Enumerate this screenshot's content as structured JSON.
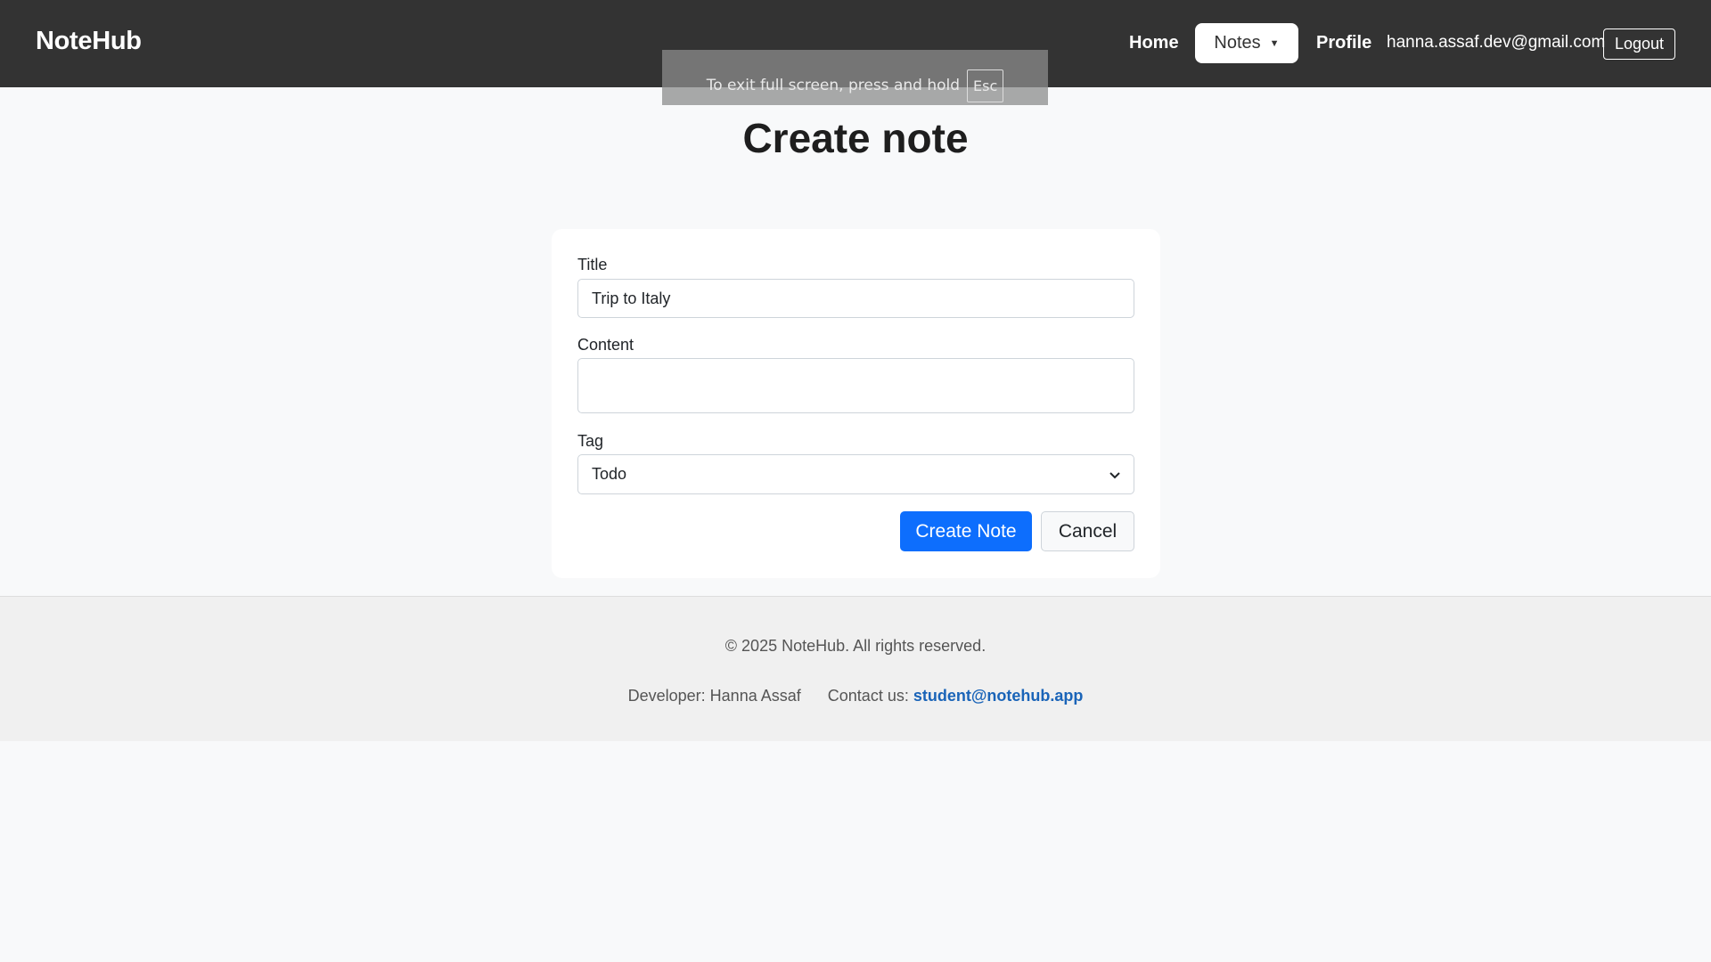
{
  "header": {
    "logo": "NoteHub",
    "nav": {
      "home": "Home",
      "notes": "Notes",
      "profile": "Profile"
    },
    "user_email": "hanna.assaf.dev@gmail.com",
    "logout": "Logout"
  },
  "fullscreen_notice": {
    "text": "To exit full screen, press and hold",
    "key": "Esc"
  },
  "page": {
    "title": "Create note"
  },
  "form": {
    "title_label": "Title",
    "title_value": "Trip to Italy",
    "content_label": "Content",
    "content_value": "",
    "tag_label": "Tag",
    "tag_value": "Todo",
    "submit": "Create Note",
    "cancel": "Cancel"
  },
  "footer": {
    "copyright": "© 2025 NoteHub. All rights reserved.",
    "developer": "Developer: Hanna Assaf",
    "contact_label": "Contact us:",
    "contact_email": "student@notehub.app"
  },
  "colors": {
    "header_bg": "#333333",
    "primary": "#0d6efd",
    "link": "#1a64b8",
    "page_bg": "#f8f9fa",
    "footer_bg": "#f0f0f0"
  }
}
